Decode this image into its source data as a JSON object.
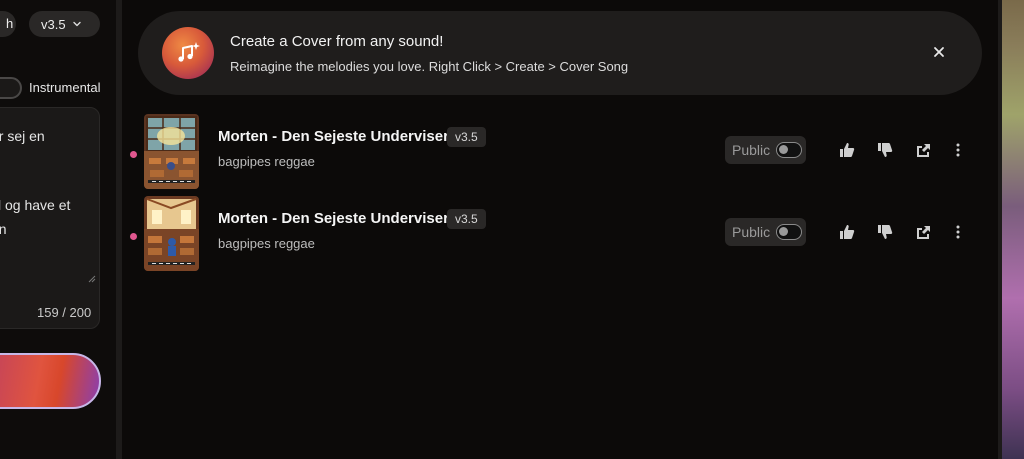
{
  "sidebar": {
    "mode_label": "h",
    "version_select": "v3.5",
    "instrumental_label": "Instrumental",
    "lyrics_lines": [
      "or sej en",
      "til og have et",
      "en"
    ],
    "char_count": "159 / 200"
  },
  "banner": {
    "title": "Create a Cover from any sound!",
    "subtitle": "Reimagine the melodies you love. Right Click > Create > Cover Song"
  },
  "songs": [
    {
      "title": "Morten - Den Sejeste Underviser",
      "version": "v3.5",
      "tags": "bagpipes reggae",
      "public_label": "Public"
    },
    {
      "title": "Morten - Den Sejeste Underviser",
      "version": "v3.5",
      "tags": "bagpipes reggae",
      "public_label": "Public"
    }
  ],
  "colors": {
    "accent_dot": "#e0568e",
    "banner_bg": "#1f1d1c",
    "icon_gradient_start": "#ef8a44",
    "icon_gradient_end": "#862e4d"
  },
  "icons": [
    "chevron-down-icon",
    "music-sparkle-icon",
    "close-icon",
    "thumbs-up-icon",
    "thumbs-down-icon",
    "share-icon",
    "more-vertical-icon"
  ]
}
